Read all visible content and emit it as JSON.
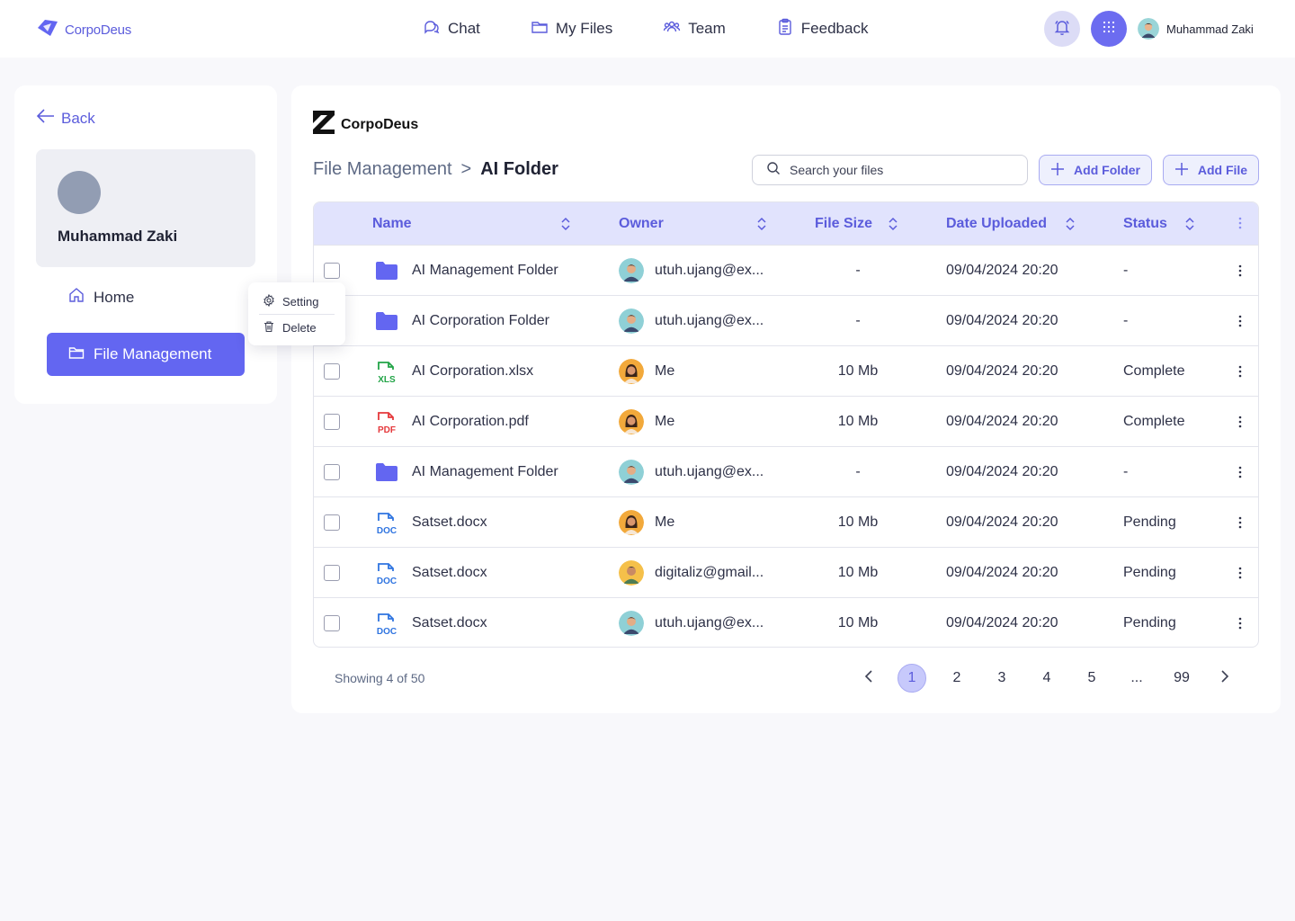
{
  "brand": {
    "name": "CorpoDeus"
  },
  "nav": {
    "items": [
      {
        "label": "Chat",
        "icon": "chat-icon"
      },
      {
        "label": "My Files",
        "icon": "folder-icon"
      },
      {
        "label": "Team",
        "icon": "team-icon"
      },
      {
        "label": "Feedback",
        "icon": "clipboard-icon"
      }
    ],
    "user_name": "Muhammad Zaki"
  },
  "sidebar": {
    "back_label": "Back",
    "profile_name": "Muhammad Zaki",
    "home_label": "Home",
    "file_management_label": "File Management"
  },
  "context_menu": {
    "setting_label": "Setting",
    "delete_label": "Delete"
  },
  "main": {
    "logo_text": "CorpoDeus",
    "breadcrumb_root": "File Management",
    "breadcrumb_sep": ">",
    "breadcrumb_current": "AI Folder",
    "search_placeholder": "Search your files",
    "add_folder_label": "Add Folder",
    "add_file_label": "Add File"
  },
  "table": {
    "columns": {
      "name": "Name",
      "owner": "Owner",
      "size": "File Size",
      "date": "Date Uploaded",
      "status": "Status"
    },
    "rows": [
      {
        "name": "AI Management Folder",
        "type": "folder",
        "owner": "utuh.ujang@ex...",
        "owner_avatar": "man-blue",
        "size": "-",
        "date": "09/04/2024 20:20",
        "status": "-"
      },
      {
        "name": "AI Corporation Folder",
        "type": "folder",
        "owner": "utuh.ujang@ex...",
        "owner_avatar": "man-blue",
        "size": "-",
        "date": "09/04/2024 20:20",
        "status": "-"
      },
      {
        "name": "AI Corporation.xlsx",
        "type": "xls",
        "owner": "Me",
        "owner_avatar": "woman-orange",
        "size": "10 Mb",
        "date": "09/04/2024 20:20",
        "status": "Complete"
      },
      {
        "name": "AI Corporation.pdf",
        "type": "pdf",
        "owner": "Me",
        "owner_avatar": "woman-orange",
        "size": "10 Mb",
        "date": "09/04/2024 20:20",
        "status": "Complete"
      },
      {
        "name": "AI Management Folder",
        "type": "folder",
        "owner": "utuh.ujang@ex...",
        "owner_avatar": "man-blue",
        "size": "-",
        "date": "09/04/2024 20:20",
        "status": "-"
      },
      {
        "name": "Satset.docx",
        "type": "doc",
        "owner": "Me",
        "owner_avatar": "woman-orange",
        "size": "10 Mb",
        "date": "09/04/2024 20:20",
        "status": "Pending"
      },
      {
        "name": "Satset.docx",
        "type": "doc",
        "owner": "digitaliz@gmail...",
        "owner_avatar": "man-yellow",
        "size": "10 Mb",
        "date": "09/04/2024 20:20",
        "status": "Pending"
      },
      {
        "name": "Satset.docx",
        "type": "doc",
        "owner": "utuh.ujang@ex...",
        "owner_avatar": "man-blue",
        "size": "10 Mb",
        "date": "09/04/2024 20:20",
        "status": "Pending"
      }
    ]
  },
  "pagination": {
    "showing_text": "Showing 4 of 50",
    "pages": [
      "1",
      "2",
      "3",
      "4",
      "5",
      "...",
      "99"
    ],
    "active_page": "1"
  },
  "colors": {
    "accent": "#6366f1",
    "accent_text": "#5b5cdc",
    "header_bg": "#e1e3fd",
    "xls_green": "#22a447",
    "pdf_red": "#e5383b",
    "doc_blue": "#2f74e0",
    "folder_purple": "#6366f1"
  }
}
